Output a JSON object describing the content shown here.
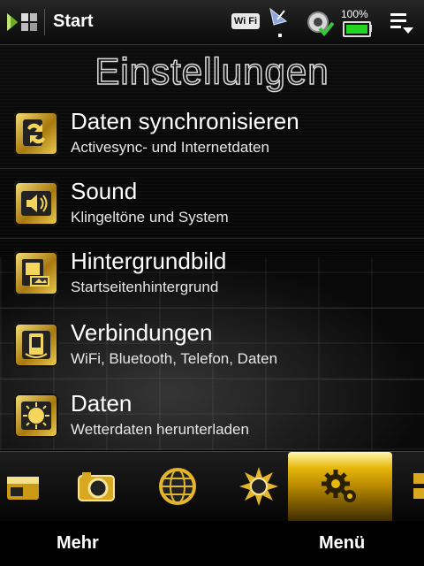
{
  "statusbar": {
    "title": "Start",
    "wifi_label": "Wi Fi",
    "battery_percent": "100%",
    "battery_level": 1.0,
    "icons": [
      "windows-start-icon",
      "wifi-icon",
      "satellite-icon",
      "sync-icon",
      "battery-icon",
      "menu-list-icon"
    ]
  },
  "page": {
    "title": "Einstellungen"
  },
  "items": [
    {
      "title": "Daten synchronisieren",
      "subtitle": "Activesync- und Internetdaten",
      "icon": "sync-icon"
    },
    {
      "title": "Sound",
      "subtitle": "Klingeltöne und System",
      "icon": "speaker-icon"
    },
    {
      "title": "Hintergrundbild",
      "subtitle": "Startseitenhintergrund",
      "icon": "wallpaper-icon"
    },
    {
      "title": "Verbindungen",
      "subtitle": "WiFi, Bluetooth, Telefon, Daten",
      "icon": "connections-icon"
    },
    {
      "title": "Daten",
      "subtitle": "Wetterdaten herunterladen",
      "icon": "weather-data-icon"
    }
  ],
  "tabs": [
    {
      "name": "music-tab",
      "icon": "music-icon",
      "active": false
    },
    {
      "name": "camera-tab",
      "icon": "camera-icon",
      "active": false
    },
    {
      "name": "internet-tab",
      "icon": "globe-icon",
      "active": false
    },
    {
      "name": "weather-tab",
      "icon": "sun-icon",
      "active": false
    },
    {
      "name": "settings-tab",
      "icon": "gears-icon",
      "active": true
    },
    {
      "name": "more-tab",
      "icon": "grid-icon",
      "active": false
    }
  ],
  "softkeys": {
    "left": "Mehr",
    "right": "Menü"
  },
  "colors": {
    "accent_gold": "#e7b70a",
    "background": "#000000",
    "text": "#ffffff"
  }
}
